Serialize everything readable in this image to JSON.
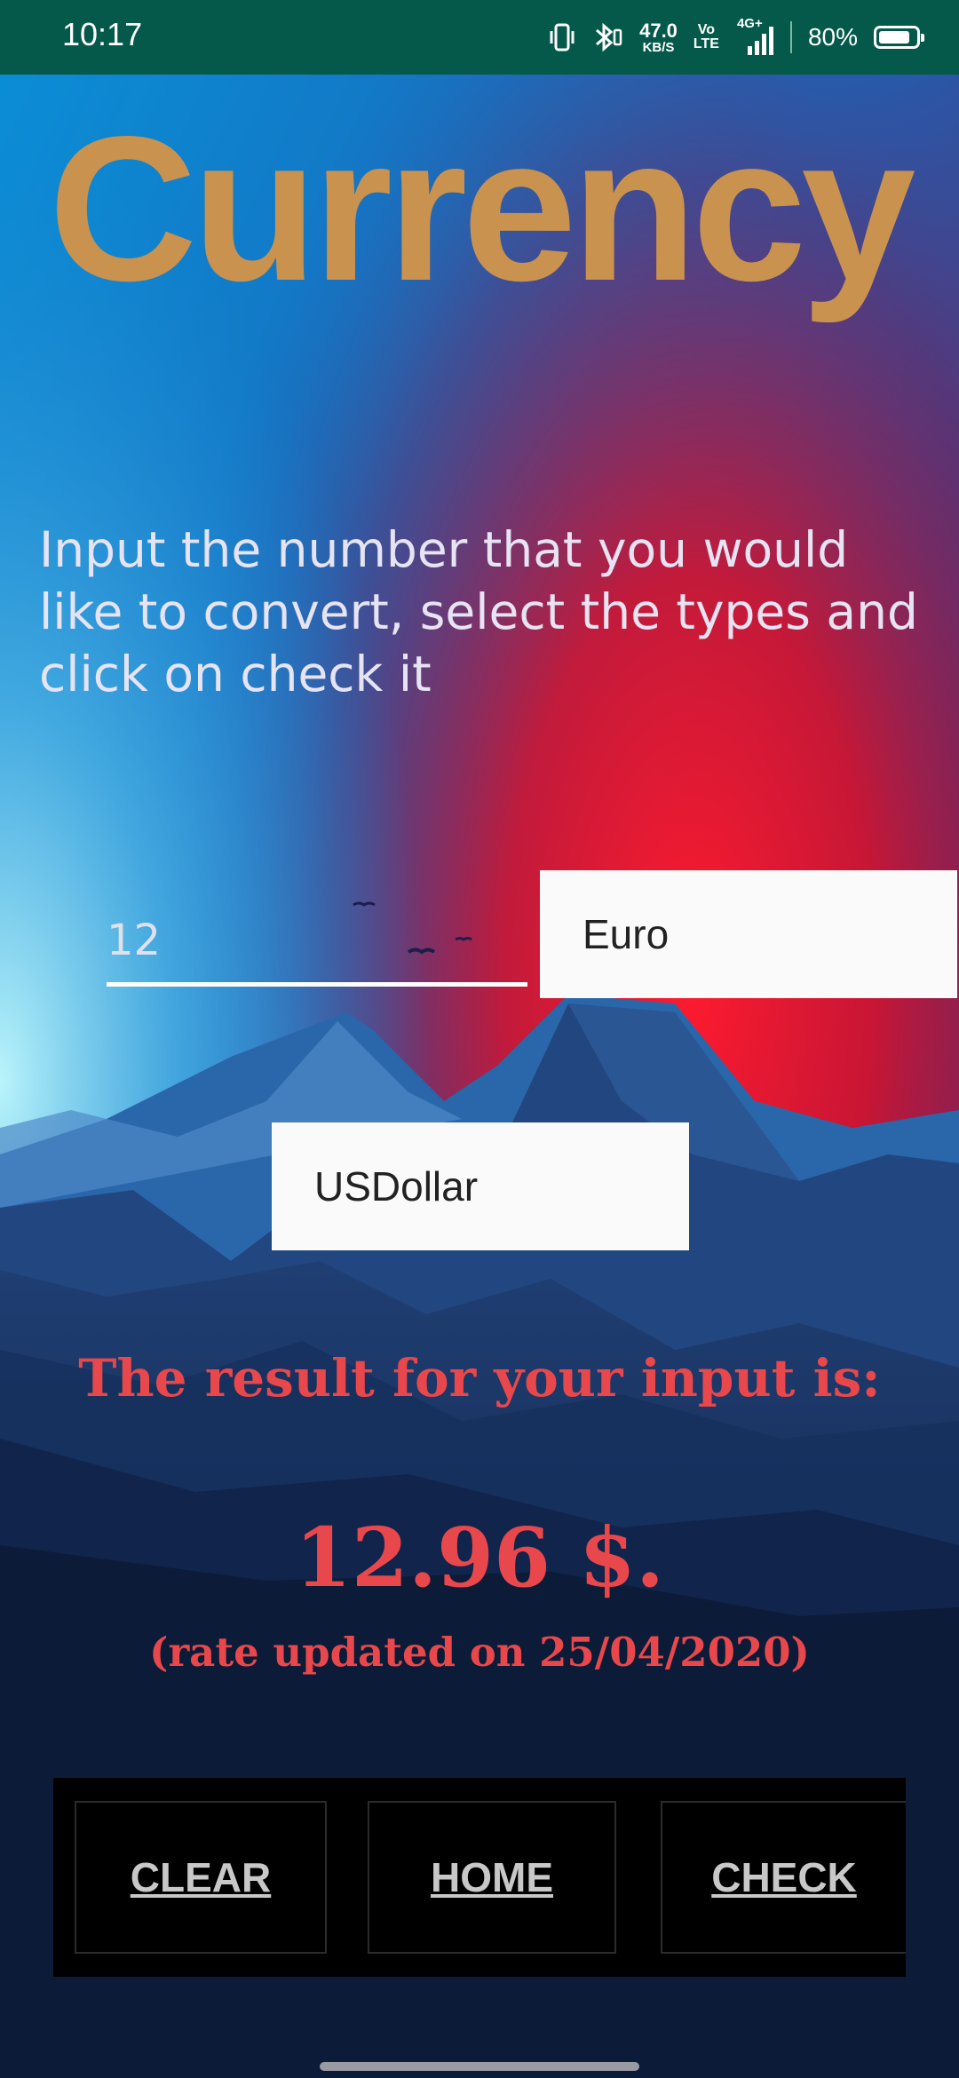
{
  "status_bar": {
    "time": "10:17",
    "net_speed_value": "47.0",
    "net_speed_unit": "KB/S",
    "volte_top": "Vo",
    "volte_bottom": "LTE",
    "signal_label": "4G+",
    "battery_percent": "80%",
    "background_color": "#04594a"
  },
  "header": {
    "title": "Currency",
    "title_color": "#c9924e"
  },
  "instructions": "Input the number that you would like to convert, select the types and click on check it",
  "form": {
    "amount_value": "12",
    "from_currency": "Euro",
    "to_currency": "USDollar"
  },
  "result": {
    "label": "The result for your input is:",
    "value": "12.96 $.",
    "rate_note": "(rate updated on 25/04/2020)",
    "color": "#e8484b"
  },
  "buttons": {
    "clear": "CLEAR",
    "home": "HOME",
    "check": "CHECK"
  }
}
